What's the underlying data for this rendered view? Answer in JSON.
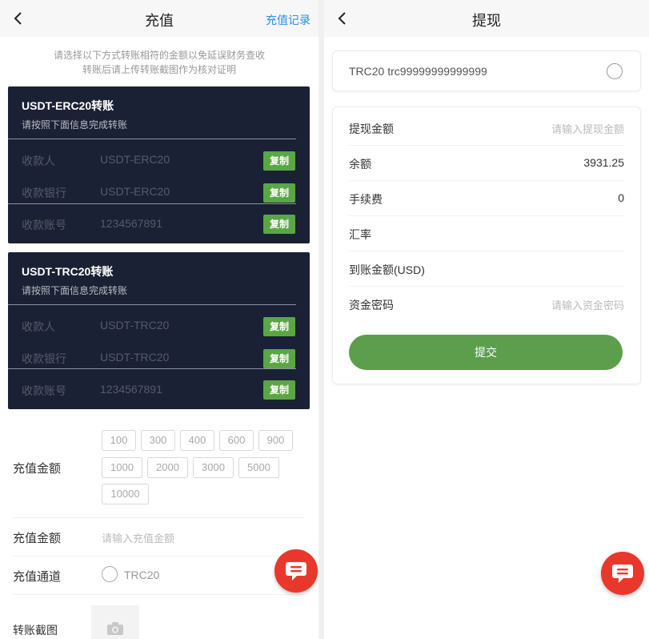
{
  "deposit": {
    "header": {
      "title": "充值",
      "record_link": "充值记录"
    },
    "notice": [
      "请选择以下方式转账相符的金额以免延误财务查收",
      "转账后请上传转账截图作为核对证明"
    ],
    "cards": [
      {
        "title": "USDT-ERC20转账",
        "subtitle": "请按照下面信息完成转账",
        "rows": [
          {
            "label": "收款人",
            "value": "USDT-ERC20",
            "copy": "复制"
          },
          {
            "label": "收款银行",
            "value": "USDT-ERC20",
            "copy": "复制"
          },
          {
            "label": "收款账号",
            "value": "1234567891",
            "copy": "复制"
          }
        ]
      },
      {
        "title": "USDT-TRC20转账",
        "subtitle": "请按照下面信息完成转账",
        "rows": [
          {
            "label": "收款人",
            "value": "USDT-TRC20",
            "copy": "复制"
          },
          {
            "label": "收款银行",
            "value": "USDT-TRC20",
            "copy": "复制"
          },
          {
            "label": "收款账号",
            "value": "1234567891",
            "copy": "复制"
          }
        ]
      }
    ],
    "amount_label": "充值金额",
    "amount_options": [
      "100",
      "300",
      "400",
      "600",
      "900",
      "1000",
      "2000",
      "3000",
      "5000",
      "10000"
    ],
    "amount_input_label": "充值金额",
    "amount_input_placeholder": "请输入充值金额",
    "channel_label": "充值通道",
    "channel_option": "TRC20",
    "screenshot_label": "转账截图"
  },
  "withdraw": {
    "header": {
      "title": "提现"
    },
    "address": "TRC20 trc99999999999999",
    "fields": [
      {
        "label": "提现金额",
        "placeholder": "请输入提现金额"
      },
      {
        "label": "余额",
        "value": "3931.25"
      },
      {
        "label": "手续费",
        "value": "0"
      },
      {
        "label": "汇率",
        "value": ""
      },
      {
        "label": "到账金额(USD)",
        "value": ""
      },
      {
        "label": "资金密码",
        "placeholder": "请输入资金密码"
      }
    ],
    "submit": "提交"
  },
  "icons": {
    "back": "chevron-left-icon",
    "chat": "chat-bubble-icon",
    "camera": "camera-icon"
  },
  "colors": {
    "accent_blue": "#2d8cf0",
    "card_bg": "#1b2134",
    "copy_green": "#5ba644",
    "submit_green": "#5c9e4c",
    "fab_red": "#e8382b"
  }
}
